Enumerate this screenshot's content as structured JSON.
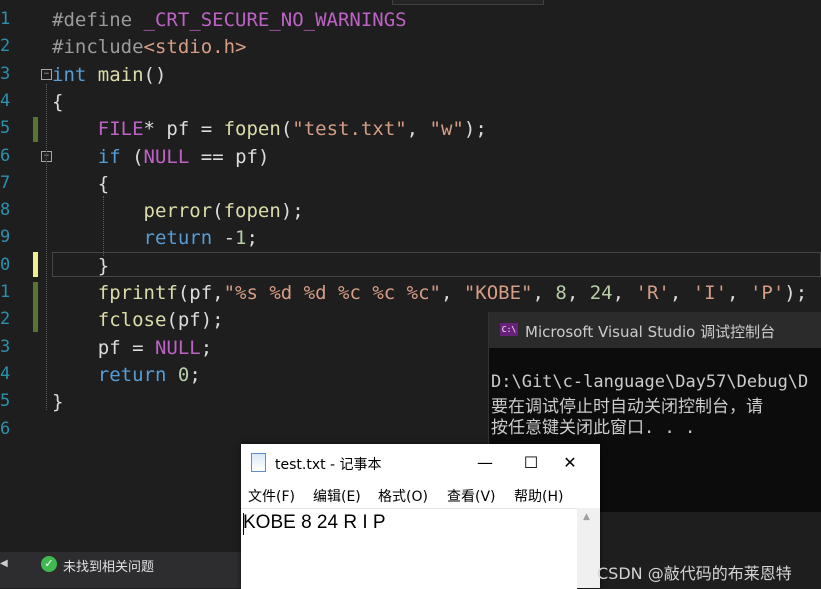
{
  "editor": {
    "line_numbers": [
      "1",
      "2",
      "3",
      "4",
      "5",
      "6",
      "7",
      "8",
      "9",
      "0",
      "1",
      "2",
      "3",
      "4",
      "5",
      "6"
    ],
    "lines": [
      [
        {
          "t": "#define ",
          "c": "pp"
        },
        {
          "t": "_CRT_SECURE_NO_WARNINGS",
          "c": "mac"
        }
      ],
      [
        {
          "t": "#include",
          "c": "pp"
        },
        {
          "t": "<stdio.h>",
          "c": "str"
        }
      ],
      [
        {
          "t": "int",
          "c": "kw"
        },
        {
          "t": " ",
          "c": "plain"
        },
        {
          "t": "main",
          "c": "fn"
        },
        {
          "t": "()",
          "c": "plain"
        }
      ],
      [
        {
          "t": "{",
          "c": "plain"
        }
      ],
      [
        {
          "t": "    ",
          "c": "plain"
        },
        {
          "t": "FILE",
          "c": "mac"
        },
        {
          "t": "* pf = ",
          "c": "plain"
        },
        {
          "t": "fopen",
          "c": "fn"
        },
        {
          "t": "(",
          "c": "plain"
        },
        {
          "t": "\"test.txt\"",
          "c": "str"
        },
        {
          "t": ", ",
          "c": "plain"
        },
        {
          "t": "\"w\"",
          "c": "str"
        },
        {
          "t": ");",
          "c": "plain"
        }
      ],
      [
        {
          "t": "    ",
          "c": "plain"
        },
        {
          "t": "if",
          "c": "kw"
        },
        {
          "t": " (",
          "c": "plain"
        },
        {
          "t": "NULL",
          "c": "mac"
        },
        {
          "t": " == pf)",
          "c": "plain"
        }
      ],
      [
        {
          "t": "    {",
          "c": "plain"
        }
      ],
      [
        {
          "t": "        ",
          "c": "plain"
        },
        {
          "t": "perror",
          "c": "fn"
        },
        {
          "t": "(",
          "c": "plain"
        },
        {
          "t": "fopen",
          "c": "fn"
        },
        {
          "t": ");",
          "c": "plain"
        }
      ],
      [
        {
          "t": "        ",
          "c": "plain"
        },
        {
          "t": "return",
          "c": "kw"
        },
        {
          "t": " -",
          "c": "plain"
        },
        {
          "t": "1",
          "c": "num"
        },
        {
          "t": ";",
          "c": "plain"
        }
      ],
      [
        {
          "t": "    }",
          "c": "plain"
        }
      ],
      [
        {
          "t": "    ",
          "c": "plain"
        },
        {
          "t": "fprintf",
          "c": "fn"
        },
        {
          "t": "(pf,",
          "c": "plain"
        },
        {
          "t": "\"%s %d %d %c %c %c\"",
          "c": "str"
        },
        {
          "t": ", ",
          "c": "plain"
        },
        {
          "t": "\"KOBE\"",
          "c": "str"
        },
        {
          "t": ", ",
          "c": "plain"
        },
        {
          "t": "8",
          "c": "num"
        },
        {
          "t": ", ",
          "c": "plain"
        },
        {
          "t": "24",
          "c": "num"
        },
        {
          "t": ", ",
          "c": "plain"
        },
        {
          "t": "'R'",
          "c": "str"
        },
        {
          "t": ", ",
          "c": "plain"
        },
        {
          "t": "'I'",
          "c": "str"
        },
        {
          "t": ", ",
          "c": "plain"
        },
        {
          "t": "'P'",
          "c": "str"
        },
        {
          "t": ");",
          "c": "plain"
        }
      ],
      [
        {
          "t": "    ",
          "c": "plain"
        },
        {
          "t": "fclose",
          "c": "fn"
        },
        {
          "t": "(pf);",
          "c": "plain"
        }
      ],
      [
        {
          "t": "    pf = ",
          "c": "plain"
        },
        {
          "t": "NULL",
          "c": "mac"
        },
        {
          "t": ";",
          "c": "plain"
        }
      ],
      [
        {
          "t": "    ",
          "c": "plain"
        },
        {
          "t": "return",
          "c": "kw"
        },
        {
          "t": " ",
          "c": "plain"
        },
        {
          "t": "0",
          "c": "num"
        },
        {
          "t": ";",
          "c": "plain"
        }
      ],
      [
        {
          "t": "}",
          "c": "plain"
        }
      ],
      []
    ]
  },
  "status_bar": {
    "message": "未找到相关问题",
    "icon": "check-circle-icon",
    "icon_glyph": "✓",
    "left_arrow": "◀"
  },
  "console": {
    "title": "Microsoft Visual Studio 调试控制台",
    "icon_text": "C:\\",
    "lines": [
      "D:\\Git\\c-language\\Day57\\Debug\\D",
      "要在调试停止时自动关闭控制台，请",
      "按任意键关闭此窗口. . ."
    ]
  },
  "notepad": {
    "title": "test.txt - 记事本",
    "menu": [
      "文件(F)",
      "编辑(E)",
      "格式(O)",
      "查看(V)",
      "帮助(H)"
    ],
    "content": "KOBE 8 24 R I P",
    "minimize": "—",
    "maximize": "☐",
    "close": "✕",
    "scroll_up": "▲"
  },
  "watermark": "CSDN @敲代码的布莱恩特",
  "colors": {
    "editor_bg": "#1e1e1e",
    "keyword": "#569cd6",
    "string": "#d69d85",
    "macro": "#bd63c5",
    "function": "#dcdcaa",
    "number": "#b5cea8"
  }
}
